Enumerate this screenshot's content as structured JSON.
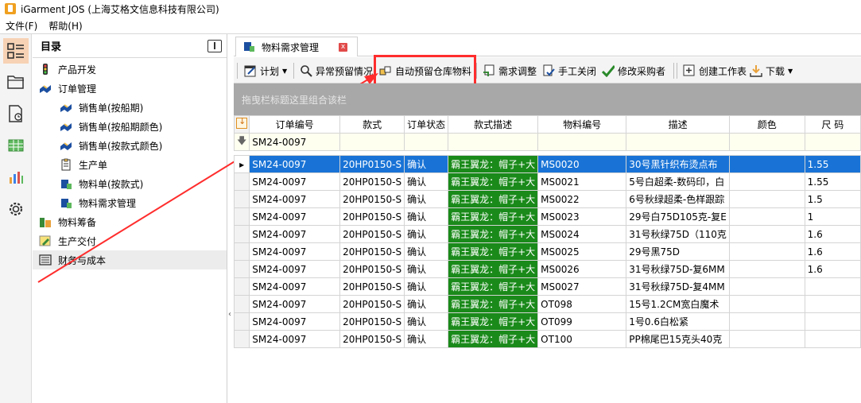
{
  "window": {
    "title": "iGarment JOS (上海艾格文信息科技有限公司)"
  },
  "menu": [
    {
      "label": "文件(F)"
    },
    {
      "label": "帮助(H)"
    }
  ],
  "rail": [
    "app-menu-icon",
    "folder-icon",
    "report-icon",
    "table-icon",
    "bar-chart-icon",
    "gear-icon"
  ],
  "nav": {
    "header": "目录",
    "items": [
      {
        "label": "产品开发",
        "level": 0,
        "icon": "traffic-light-icon"
      },
      {
        "label": "订单管理",
        "level": 0,
        "icon": "handshake-icon"
      },
      {
        "label": "销售单(按船期)",
        "level": 1,
        "icon": "handshake-icon"
      },
      {
        "label": "销售单(按船期颜色)",
        "level": 1,
        "icon": "handshake-icon"
      },
      {
        "label": "销售单(按款式颜色)",
        "level": 1,
        "icon": "handshake-icon"
      },
      {
        "label": "生产单",
        "level": 1,
        "icon": "clipboard-icon"
      },
      {
        "label": "物料单(按款式)",
        "level": 1,
        "icon": "material-icon"
      },
      {
        "label": "物料需求管理",
        "level": 1,
        "icon": "material-icon"
      },
      {
        "label": "物料筹备",
        "level": 0,
        "icon": "stack-icon"
      },
      {
        "label": "生产交付",
        "level": 0,
        "icon": "pencil-icon"
      },
      {
        "label": "财务与成本",
        "level": 0,
        "icon": "list-icon",
        "selected": true
      }
    ]
  },
  "tab": {
    "label": "物料需求管理",
    "close": "x"
  },
  "toolbar": {
    "plan": "计划",
    "abnormal": "异常预留情况",
    "auto_reserve": "自动预留仓库物料",
    "demand_adjust": "需求调整",
    "manual_close": "手工关闭",
    "modify_buyer": "修改采购者",
    "create_worksheet": "创建工作表",
    "download": "下载"
  },
  "group_bar": {
    "placeholder": "拖曳栏标题这里组合该栏"
  },
  "grid": {
    "columns": [
      "订单编号",
      "款式",
      "订单状态",
      "款式描述",
      "物料编号",
      "描述",
      "颜色",
      "尺 码"
    ],
    "filter": [
      "SM24-0097",
      "",
      "",
      "",
      "",
      "",
      "",
      ""
    ],
    "rows": [
      [
        "SM24-0097",
        "20HP0150-S",
        "确认",
        "霸王翼龙：帽子+大",
        "MS0020",
        "30号黑针织布烫点布",
        "",
        "1.55"
      ],
      [
        "SM24-0097",
        "20HP0150-S",
        "确认",
        "霸王翼龙：帽子+大",
        "MS0021",
        "5号白超柔-数码印，白",
        "",
        "1.55"
      ],
      [
        "SM24-0097",
        "20HP0150-S",
        "确认",
        "霸王翼龙：帽子+大",
        "MS0022",
        "6号秋绿超柔-色样跟踪",
        "",
        "1.5"
      ],
      [
        "SM24-0097",
        "20HP0150-S",
        "确认",
        "霸王翼龙：帽子+大",
        "MS0023",
        "29号白75D105克-复E",
        "",
        "1"
      ],
      [
        "SM24-0097",
        "20HP0150-S",
        "确认",
        "霸王翼龙：帽子+大",
        "MS0024",
        "31号秋绿75D（110克",
        "",
        "1.6"
      ],
      [
        "SM24-0097",
        "20HP0150-S",
        "确认",
        "霸王翼龙：帽子+大",
        "MS0025",
        "29号黑75D",
        "",
        "1.6"
      ],
      [
        "SM24-0097",
        "20HP0150-S",
        "确认",
        "霸王翼龙：帽子+大",
        "MS0026",
        "31号秋绿75D-复6MM",
        "",
        "1.6"
      ],
      [
        "SM24-0097",
        "20HP0150-S",
        "确认",
        "霸王翼龙：帽子+大",
        "MS0027",
        "31号秋绿75D-复4MM",
        "",
        ""
      ],
      [
        "SM24-0097",
        "20HP0150-S",
        "确认",
        "霸王翼龙：帽子+大",
        "OT098",
        "15号1.2CM宽白魔术",
        "",
        ""
      ],
      [
        "SM24-0097",
        "20HP0150-S",
        "确认",
        "霸王翼龙：帽子+大",
        "OT099",
        "1号0.6白松紧",
        "",
        ""
      ],
      [
        "SM24-0097",
        "20HP0150-S",
        "确认",
        "霸王翼龙：帽子+大",
        "OT100",
        "PP棉尾巴15克头40克",
        "",
        ""
      ]
    ]
  },
  "colors": {
    "selection": "#1973d6",
    "style_desc_bg": "#1a8a1a",
    "highlight": "#ff2d2d",
    "rail_active": "#f7d2b4"
  }
}
